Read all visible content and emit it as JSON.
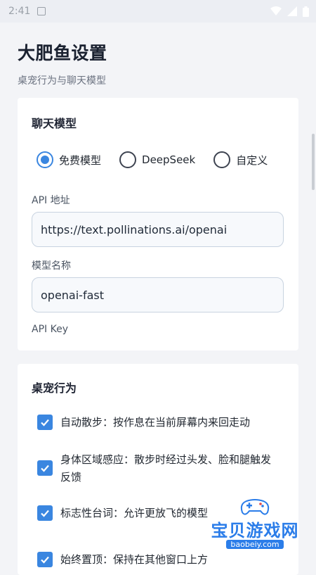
{
  "status_bar": {
    "time": "2:41"
  },
  "header": {
    "title": "大肥鱼设置",
    "subtitle": "桌宠行为与聊天模型"
  },
  "chat_model": {
    "title": "聊天模型",
    "options": [
      {
        "label": "免费模型",
        "checked": true
      },
      {
        "label": "DeepSeek",
        "checked": false
      },
      {
        "label": "自定义",
        "checked": false
      }
    ],
    "api_url_label": "API 地址",
    "api_url_value": "https://text.pollinations.ai/openai",
    "model_name_label": "模型名称",
    "model_name_value": "openai-fast",
    "api_key_label": "API Key"
  },
  "pet_behavior": {
    "title": "桌宠行为",
    "items": [
      {
        "label": "自动散步：按作息在当前屏幕内来回走动",
        "checked": true
      },
      {
        "label": "身体区域感应：散步时经过头发、脸和腿触发反馈",
        "checked": true
      },
      {
        "label": "标志性台词：允许更放飞的模型",
        "checked": true
      },
      {
        "label": "始终置顶：保持在其他窗口上方",
        "checked": true
      }
    ]
  },
  "watermark": {
    "text": "宝贝游戏网",
    "url": "baobeiy.com"
  },
  "colors": {
    "accent": "#3a86e0",
    "background": "#f3f4f7",
    "card": "#ffffff"
  }
}
